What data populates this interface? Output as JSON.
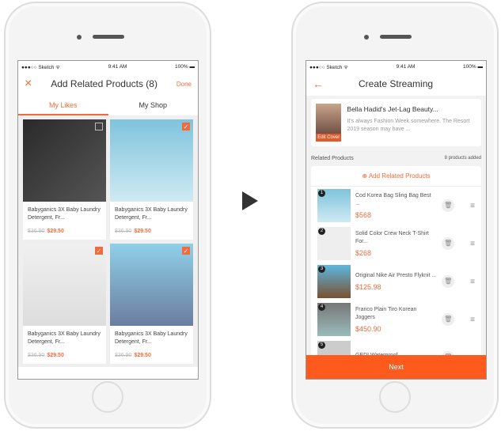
{
  "status": {
    "carrier": "●●●○○ Sketch ᯤ",
    "time": "9:41 AM",
    "battery": "100% ▬"
  },
  "left": {
    "close_icon": "×",
    "title": "Add Related Products (8)",
    "done": "Done",
    "tabs": [
      "My Likes",
      "My Shop"
    ],
    "products": [
      {
        "title": "Babyganics 3X Baby Laundry Detergent, Fr...",
        "old_price": "$36.90",
        "price": "$29.50",
        "checked": false
      },
      {
        "title": "Babyganics 3X Baby Laundry Detergent, Fr...",
        "old_price": "$36.90",
        "price": "$29.50",
        "checked": true
      },
      {
        "title": "Babyganics 3X Baby Laundry Detergent, Fr...",
        "old_price": "$36.90",
        "price": "$29.50",
        "checked": true
      },
      {
        "title": "Babyganics 3X Baby Laundry Detergent, Fr...",
        "old_price": "$36.90",
        "price": "$29.50",
        "checked": true
      }
    ]
  },
  "right": {
    "back_icon": "←",
    "title": "Create Streaming",
    "stream": {
      "title": "Bella Hadid's Jet-Lag Beauty...",
      "desc": "It's always Fashion Week somewhere. The Resort 2019 season may have ...",
      "edit_cover": "Edit Cover"
    },
    "related_label": "Related Products",
    "count": "8 products added",
    "add_label": "Add Related Products",
    "items": [
      {
        "n": "1",
        "name": "Cod Korea Bag Sling Bag Best ...",
        "price": "$568"
      },
      {
        "n": "2",
        "name": "Solid Color Crew Neck T-Shirt For...",
        "price": "$268"
      },
      {
        "n": "3",
        "name": "Original Nike Air Presto Flyknit ...",
        "price": "$125.98"
      },
      {
        "n": "4",
        "name": "Franco Plain Tiro Korean Joggers",
        "price": "$450.90"
      },
      {
        "n": "5",
        "name": "GEDI Waterproof",
        "price": ""
      }
    ],
    "next": "Next"
  },
  "colors": {
    "accent": "#f26b3a",
    "next_button": "#fe5a1d"
  }
}
